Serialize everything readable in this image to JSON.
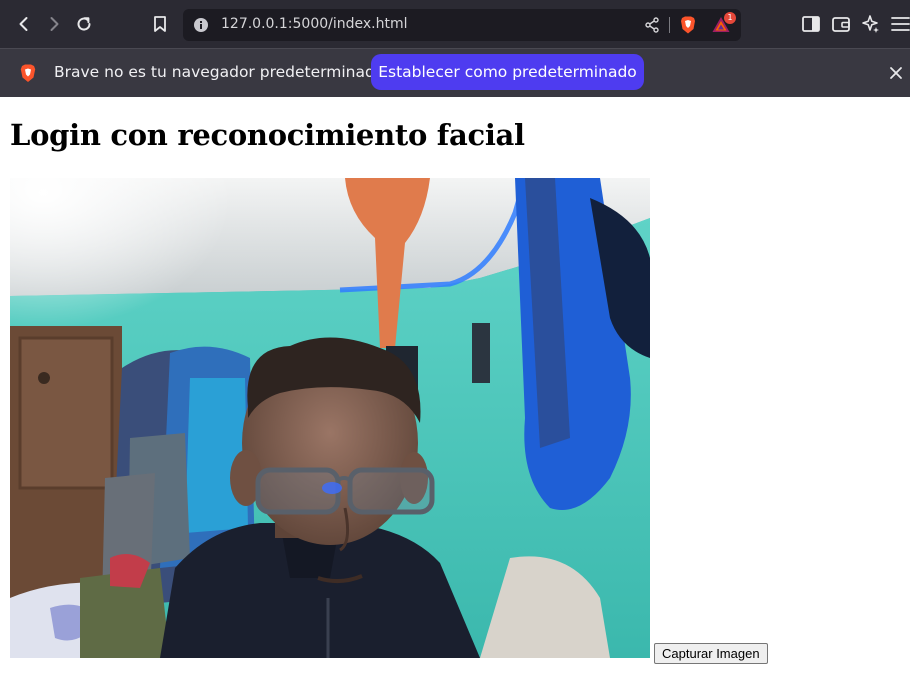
{
  "browser": {
    "url": "127.0.0.1:5000/index.html",
    "rewards_count": "1",
    "accent": "#4e3cf0",
    "icons": [
      "back-icon",
      "forward-icon",
      "reload-icon",
      "bookmark-icon",
      "site-info-icon",
      "share-icon",
      "brave-shields-icon",
      "brave-rewards-icon",
      "sidebar-icon",
      "wallet-icon",
      "leo-ai-icon",
      "menu-icon"
    ]
  },
  "infobar": {
    "message": "Brave no es tu navegador predeterminado",
    "button_label": "Establecer como predeterminado",
    "close_icon": "close-icon"
  },
  "page": {
    "title": "Login con reconocimiento facial",
    "capture_button": "Capturar Imagen"
  }
}
